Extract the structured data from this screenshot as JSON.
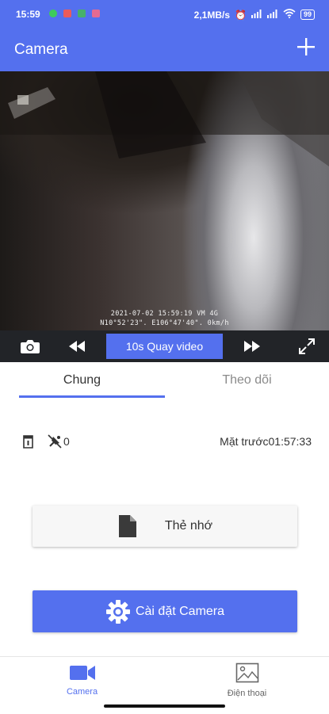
{
  "status_bar": {
    "time": "15:59",
    "speed": "2,1MB/s",
    "battery": "99"
  },
  "app_bar": {
    "title": "Camera",
    "add_icon": "plus-icon"
  },
  "video": {
    "osd_line1": "2021-07-02 15:59:19 VM 4G",
    "osd_line2": "N10°52'23\". E106°47'40\". 0km/h"
  },
  "controls": {
    "record_label": "10s Quay video",
    "icons": [
      "camera-icon",
      "rewind-icon",
      "fast-forward-icon",
      "fullscreen-icon"
    ]
  },
  "tabs": [
    {
      "label": "Chung",
      "active": true
    },
    {
      "label": "Theo dõi",
      "active": false
    }
  ],
  "info": {
    "satellite_count": "0",
    "camera_time": "Mặt trước01:57:33"
  },
  "buttons": {
    "memory_label": "Thẻ nhớ",
    "settings_label": "Cài đặt Camera"
  },
  "bottom_nav": [
    {
      "label": "Camera",
      "icon": "video-camera-icon",
      "active": true
    },
    {
      "label": "Điện thoại",
      "icon": "image-icon",
      "active": false
    }
  ],
  "colors": {
    "accent": "#5470ee",
    "controls_bg": "#222428"
  }
}
